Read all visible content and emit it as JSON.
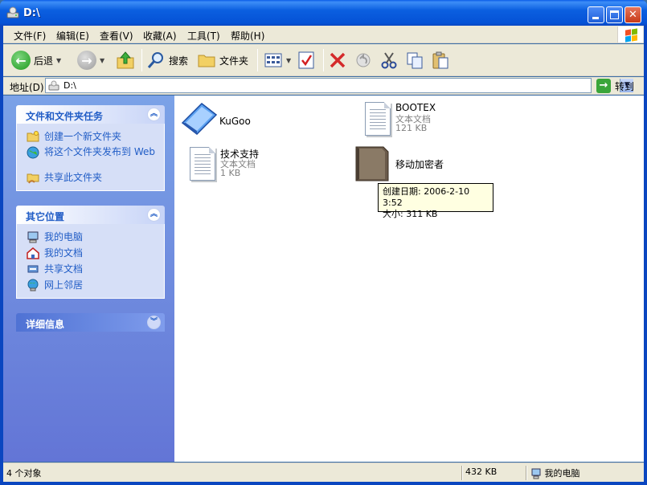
{
  "window": {
    "title": "D:\\"
  },
  "colors": {
    "titlebar": "#0552d6",
    "taskpane_text": "#215dc6",
    "tooltip_bg": "#ffffe1"
  },
  "menu": [
    {
      "label": "文件(F)"
    },
    {
      "label": "编辑(E)"
    },
    {
      "label": "查看(V)"
    },
    {
      "label": "收藏(A)"
    },
    {
      "label": "工具(T)"
    },
    {
      "label": "帮助(H)"
    }
  ],
  "toolbar": {
    "back_label": "后退",
    "search_label": "搜索",
    "folders_label": "文件夹"
  },
  "address": {
    "label": "地址(D)",
    "value": "D:\\",
    "go_label": "转到"
  },
  "tasks_panel": {
    "title": "文件和文件夹任务",
    "items": [
      {
        "label": "创建一个新文件夹",
        "icon": "new-folder-icon"
      },
      {
        "label": "将这个文件夹发布到 Web",
        "icon": "publish-web-icon"
      },
      {
        "label": "共享此文件夹",
        "icon": "share-folder-icon"
      }
    ]
  },
  "places_panel": {
    "title": "其它位置",
    "items": [
      {
        "label": "我的电脑",
        "icon": "my-computer-icon"
      },
      {
        "label": "我的文档",
        "icon": "my-documents-icon"
      },
      {
        "label": "共享文档",
        "icon": "shared-documents-icon"
      },
      {
        "label": "网上邻居",
        "icon": "network-places-icon"
      }
    ]
  },
  "details_panel": {
    "title": "详细信息"
  },
  "files": [
    {
      "name": "KuGoo",
      "type": "",
      "size": "",
      "icon": "kugoo-folder-icon"
    },
    {
      "name": "BOOTEX",
      "type": "文本文档",
      "size": "121 KB",
      "icon": "text-document-icon"
    },
    {
      "name": "技术支持",
      "type": "文本文档",
      "size": "1 KB",
      "icon": "text-document-icon"
    },
    {
      "name": "移动加密者",
      "type": "",
      "size": "",
      "icon": "encryptor-app-icon"
    }
  ],
  "tooltip": {
    "created": "创建日期: 2006-2-10 3:52",
    "size": "大小: 311 KB"
  },
  "status": {
    "count": "4 个对象",
    "size": "432 KB",
    "location": "我的电脑"
  }
}
